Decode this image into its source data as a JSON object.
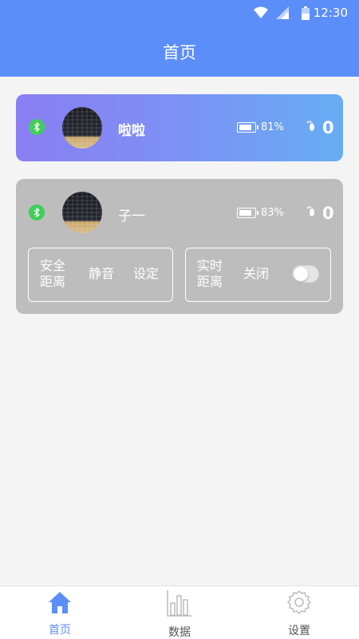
{
  "status_bar": {
    "time": "12:30"
  },
  "header": {
    "title": "首页"
  },
  "devices": [
    {
      "name": "啦啦",
      "battery": "81%",
      "battery_level": 0.81,
      "steps": "0"
    },
    {
      "name": "子一",
      "battery": "83%",
      "battery_level": 0.83,
      "steps": "0",
      "safe_distance": {
        "label_line1": "安全",
        "label_line2": "距离",
        "mode": "静音",
        "action": "设定"
      },
      "realtime_distance": {
        "label_line1": "实时",
        "label_line2": "距离",
        "state": "关闭",
        "enabled": false
      }
    }
  ],
  "tabbar": {
    "home": "首页",
    "data": "数据",
    "settings": "设置"
  },
  "colors": {
    "primary": "#5b8ef9",
    "bluetooth_dot": "#3fcf5a",
    "card_inactive": "#bdbdbd"
  }
}
